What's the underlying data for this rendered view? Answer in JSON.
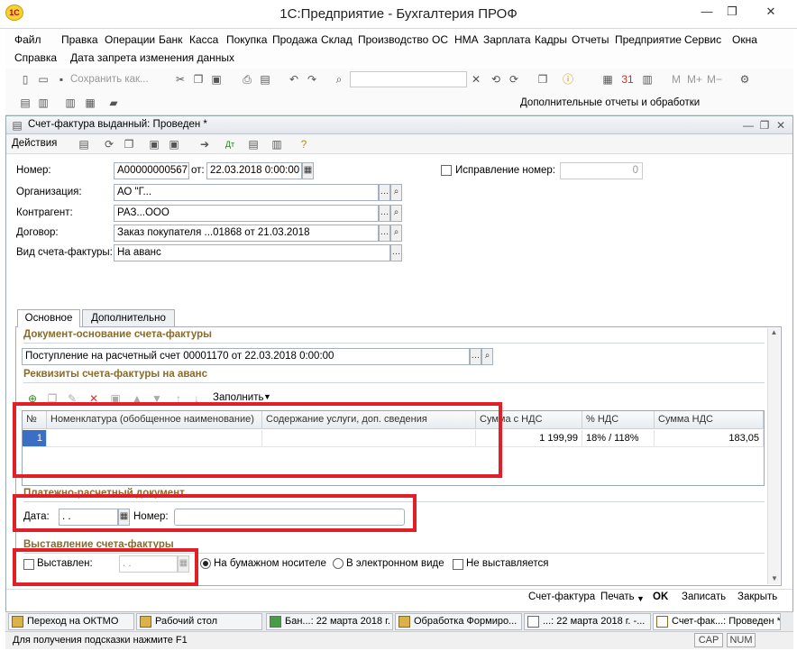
{
  "window": {
    "title": "1С:Предприятие - Бухгалтерия ПРОФ"
  },
  "menu": [
    "Файл",
    "Правка",
    "Операции",
    "Банк",
    "Касса",
    "Покупка",
    "Продажа",
    "Склад",
    "Производство",
    "ОС",
    "НМА",
    "Зарплата",
    "Кадры",
    "Отчеты",
    "Предприятие",
    "Сервис",
    "Окна",
    "Справка",
    "Дата запрета изменения данных"
  ],
  "toolbar": {
    "save_as": "Сохранить как...",
    "additional_reports": "Дополнительные отчеты и обработки"
  },
  "document": {
    "title": "Счет-фактура выданный: Проведен *",
    "actions_label": "Действия",
    "number_label": "Номер:",
    "number_value": "А00000000567",
    "date_from_label": "от:",
    "date_value": "22.03.2018  0:00:00",
    "correction_label": "Исправление номер:",
    "correction_value": "0",
    "org_label": "Организация:",
    "org_value": "АО \"Г...",
    "counterparty_label": "Контрагент:",
    "counterparty_value": "РАЗ...ООО",
    "contract_label": "Договор:",
    "contract_value": "Заказ покупателя ...01868 от 21.03.2018",
    "invoice_type_label": "Вид счета-фактуры:",
    "invoice_type_value": "На аванс"
  },
  "tabs": [
    "Основное",
    "Дополнительно"
  ],
  "basis": {
    "title": "Документ-основание счета-фактуры",
    "value": "Поступление на расчетный счет       00001170 от 22.03.2018 0:00:00"
  },
  "advance": {
    "title": "Реквизиты счета-фактуры на аванс",
    "fill_label": "Заполнить",
    "columns": [
      "№",
      "Номенклатура (обобщенное наименование)",
      "Содержание услуги, доп. сведения",
      "Сумма с НДС",
      "% НДС",
      "Сумма НДС"
    ],
    "rows": [
      [
        "1",
        "",
        "",
        "1 199,99",
        "18% / 118%",
        "183,05"
      ]
    ]
  },
  "payment": {
    "title": "Платежно-расчетный документ",
    "date_label": "Дата:",
    "date_value": " .  .",
    "number_label": "Номер:"
  },
  "issue": {
    "title": "Выставление счета-фактуры",
    "issued_label": "Выставлен:",
    "date_value": " .  .",
    "paper": "На бумажном носителе",
    "electronic": "В электронном виде",
    "not_issued": "Не выставляется"
  },
  "footer": {
    "invoice": "Счет-фактура",
    "print": "Печать",
    "ok": "OK",
    "save": "Записать",
    "close": "Закрыть"
  },
  "taskbar": [
    "Переход на ОКТМО",
    "Рабочий стол",
    "Бан...: 22 марта 2018 г.",
    "Обработка  Формиро...",
    "...: 22 марта 2018 г. -...",
    "Счет-фак...: Проведен *"
  ],
  "status": {
    "hint": "Для получения подсказки нажмите F1",
    "cap": "CAP",
    "num": "NUM"
  }
}
